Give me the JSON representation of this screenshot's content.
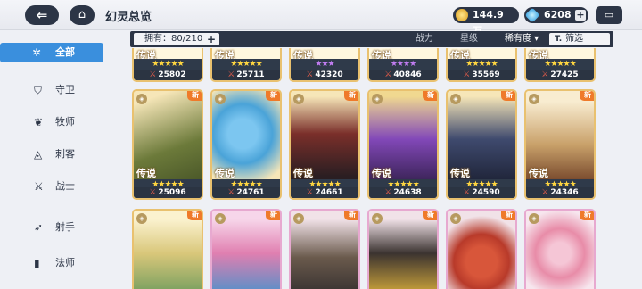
{
  "header": {
    "back_icon": "arrow-left-icon",
    "home_icon": "home-icon",
    "title": "幻灵总览",
    "gold": "144.9万",
    "gems": "6208",
    "chat_icon": "chat-bubble-icon"
  },
  "sidebar": {
    "items": [
      {
        "label": "全部",
        "icon": "star-icon",
        "active": true
      },
      {
        "label": "守卫",
        "icon": "shield-icon"
      },
      {
        "label": "牧师",
        "icon": "leaf-icon"
      },
      {
        "label": "刺客",
        "icon": "mask-icon"
      },
      {
        "label": "战士",
        "icon": "sword-icon"
      },
      {
        "label": "射手",
        "icon": "bow-icon"
      },
      {
        "label": "法师",
        "icon": "book-icon"
      }
    ]
  },
  "filterbar": {
    "owned": "拥有：80/210",
    "tab_power": "战力",
    "tab_star": "星级",
    "sort": "稀有度 ▾",
    "filter": "筛选"
  },
  "cards": {
    "row1": [
      {
        "rarity": "传说",
        "stars": "★★★★★",
        "star_color": "gold",
        "power": "25802"
      },
      {
        "rarity": "传说",
        "stars": "★★★★★",
        "star_color": "gold",
        "power": "25711"
      },
      {
        "rarity": "传说",
        "stars": "★★★",
        "star_color": "purple",
        "power": "42320"
      },
      {
        "rarity": "传说",
        "stars": "★★★★",
        "star_color": "purple",
        "power": "40846"
      },
      {
        "rarity": "传说",
        "stars": "★★★★★",
        "star_color": "gold",
        "power": "35569"
      },
      {
        "rarity": "传说",
        "stars": "★★★★★",
        "star_color": "gold",
        "power": "27425"
      }
    ],
    "row2": [
      {
        "rarity": "传说",
        "stars": "★★★★★",
        "power": "25096",
        "new": "新",
        "art": "#6c7a3a"
      },
      {
        "rarity": "传说",
        "stars": "★★★★★",
        "power": "24761",
        "new": "新",
        "art": "#4aa3d8"
      },
      {
        "rarity": "传说",
        "stars": "★★★★★",
        "power": "24661",
        "new": "新",
        "art": "#7a2f2a"
      },
      {
        "rarity": "传说",
        "stars": "★★★★★",
        "power": "24638",
        "new": "新",
        "art": "#8248b8"
      },
      {
        "rarity": "传说",
        "stars": "★★★★★",
        "power": "24590",
        "new": "新",
        "art": "#3f4a6e"
      },
      {
        "rarity": "传说",
        "stars": "★★★★★",
        "power": "24346",
        "new": "新",
        "art": "#c9a16a"
      }
    ],
    "row3": [
      {
        "new": "新",
        "art": "#d9c77a"
      },
      {
        "new": "新",
        "art": "#e07fb0"
      },
      {
        "new": "新",
        "art": "#6a5a4c"
      },
      {
        "new": "新",
        "art": "#3b3330"
      },
      {
        "new": "新",
        "art": "#d8563a"
      },
      {
        "new": "新",
        "art": "#e88ca8"
      }
    ]
  }
}
